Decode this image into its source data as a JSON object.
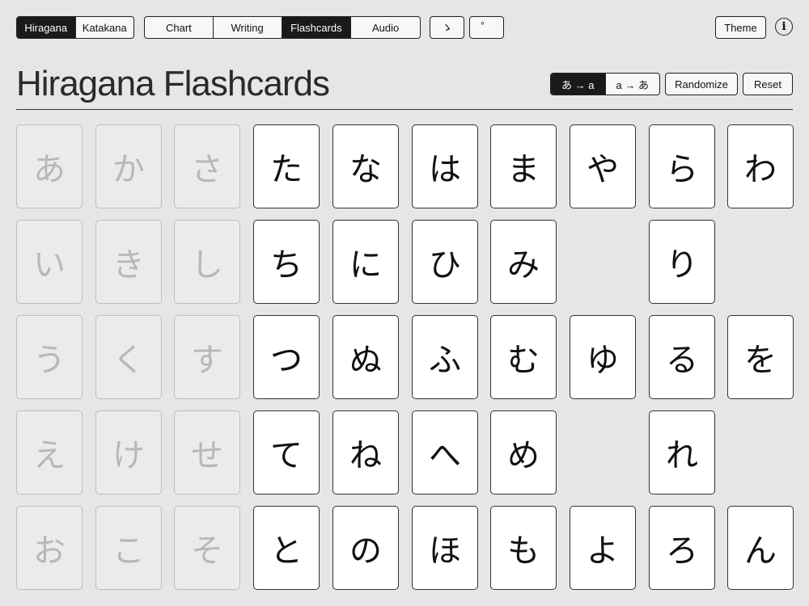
{
  "toolbar": {
    "script_tabs": [
      {
        "label": "Hiragana",
        "active": true
      },
      {
        "label": "Katakana",
        "active": false
      }
    ],
    "view_tabs": [
      {
        "label": "Chart",
        "active": false
      },
      {
        "label": "Writing",
        "active": false
      },
      {
        "label": "Flashcards",
        "active": true
      },
      {
        "label": "Audio",
        "active": false
      }
    ],
    "mark_buttons": [
      "ゝ",
      "゜"
    ],
    "theme_label": "Theme",
    "info_label": "i"
  },
  "header": {
    "title": "Hiragana Flashcards",
    "direction_modes": [
      {
        "label": "あ → a",
        "active": true
      },
      {
        "label": "a → あ",
        "active": false
      }
    ],
    "randomize_label": "Randomize",
    "reset_label": "Reset"
  },
  "grid": {
    "columns": [
      {
        "kana": [
          "あ",
          "い",
          "う",
          "え",
          "お"
        ],
        "faded": true
      },
      {
        "kana": [
          "か",
          "き",
          "く",
          "け",
          "こ"
        ],
        "faded": true
      },
      {
        "kana": [
          "さ",
          "し",
          "す",
          "せ",
          "そ"
        ],
        "faded": true
      },
      {
        "kana": [
          "た",
          "ち",
          "つ",
          "て",
          "と"
        ],
        "faded": false
      },
      {
        "kana": [
          "な",
          "に",
          "ぬ",
          "ね",
          "の"
        ],
        "faded": false
      },
      {
        "kana": [
          "は",
          "ひ",
          "ふ",
          "へ",
          "ほ"
        ],
        "faded": false
      },
      {
        "kana": [
          "ま",
          "み",
          "む",
          "め",
          "も"
        ],
        "faded": false
      },
      {
        "kana": [
          "や",
          "",
          "ゆ",
          "",
          "よ"
        ],
        "faded": false
      },
      {
        "kana": [
          "ら",
          "り",
          "る",
          "れ",
          "ろ"
        ],
        "faded": false
      },
      {
        "kana": [
          "わ",
          "",
          "を",
          "",
          "ん"
        ],
        "faded": false
      }
    ]
  }
}
